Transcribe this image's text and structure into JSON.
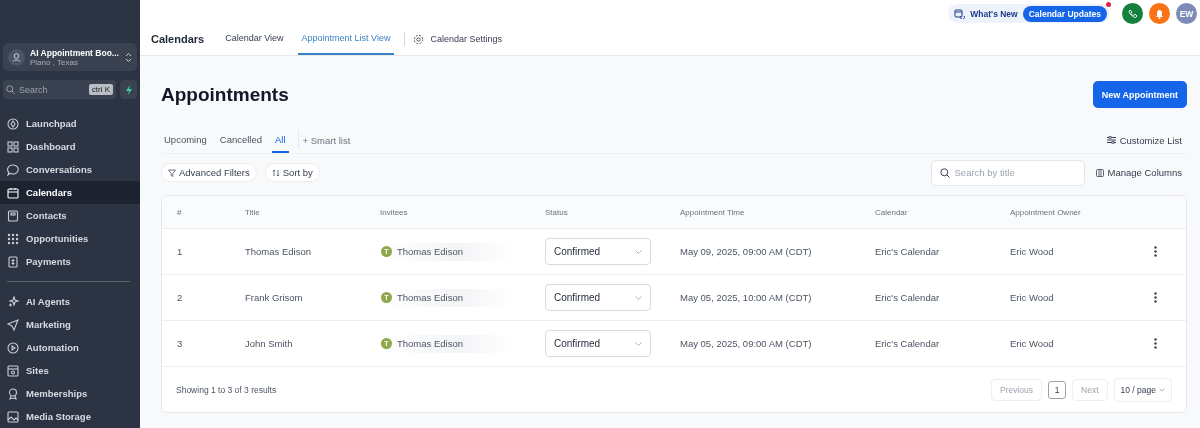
{
  "sidebar": {
    "account": {
      "name": "AI Appointment Boo...",
      "location": "Plano , Texas"
    },
    "search": {
      "placeholder": "Search",
      "shortcut": "ctrl K"
    },
    "groups": [
      [
        {
          "label": "Launchpad",
          "selected": false
        },
        {
          "label": "Dashboard",
          "selected": false
        },
        {
          "label": "Conversations",
          "selected": false
        },
        {
          "label": "Calendars",
          "selected": true
        },
        {
          "label": "Contacts",
          "selected": false
        },
        {
          "label": "Opportunities",
          "selected": false
        },
        {
          "label": "Payments",
          "selected": false
        }
      ],
      [
        {
          "label": "AI Agents",
          "selected": false
        },
        {
          "label": "Marketing",
          "selected": false
        },
        {
          "label": "Automation",
          "selected": false
        },
        {
          "label": "Sites",
          "selected": false
        },
        {
          "label": "Memberships",
          "selected": false
        },
        {
          "label": "Media Storage",
          "selected": false
        }
      ]
    ]
  },
  "topbar": {
    "whats_new": "What's New",
    "update_badge": "Calendar Updates",
    "avatar": "EW"
  },
  "header": {
    "title": "Calendars",
    "tabs": [
      {
        "label": "Calendar View",
        "selected": false
      },
      {
        "label": "Appointment List View",
        "selected": true
      }
    ],
    "settings": "Calendar Settings"
  },
  "page": {
    "title": "Appointments",
    "new_button": "New Appointment",
    "filter_tabs": [
      {
        "label": "Upcoming",
        "selected": false
      },
      {
        "label": "Cancelled",
        "selected": false
      },
      {
        "label": "All",
        "selected": true
      }
    ],
    "smart_list": "+ Smart list",
    "customize": "Customize List",
    "advanced_filters": "Advanced Filters",
    "sort_by": "Sort by",
    "search": {
      "placeholder": "Search by title"
    },
    "manage_columns": "Manage Columns"
  },
  "table": {
    "columns": [
      "#",
      "Title",
      "Invitees",
      "Status",
      "Appointment Time",
      "Calendar",
      "Appointment Owner"
    ],
    "rows": [
      {
        "index": "1",
        "title": "Thomas Edison",
        "invitee_initial": "T",
        "invitee": "Thomas Edison",
        "status": "Confirmed",
        "time": "May 09, 2025, 09:00 AM (CDT)",
        "calendar": "Eric's Calendar",
        "owner": "Eric Wood"
      },
      {
        "index": "2",
        "title": "Frank Grisom",
        "invitee_initial": "T",
        "invitee": "Thomas Edison",
        "status": "Confirmed",
        "time": "May 05, 2025, 10:00 AM (CDT)",
        "calendar": "Eric's Calendar",
        "owner": "Eric Wood"
      },
      {
        "index": "3",
        "title": "John Smith",
        "invitee_initial": "T",
        "invitee": "Thomas Edison",
        "status": "Confirmed",
        "time": "May 05, 2025, 09:00 AM (CDT)",
        "calendar": "Eric's Calendar",
        "owner": "Eric Wood"
      }
    ],
    "summary": "Showing 1 to 3 of 3 results",
    "pagination": {
      "previous": "Previous",
      "pages": [
        {
          "label": "1",
          "selected": true
        }
      ],
      "next": "Next",
      "page_size": "10 / page"
    }
  }
}
